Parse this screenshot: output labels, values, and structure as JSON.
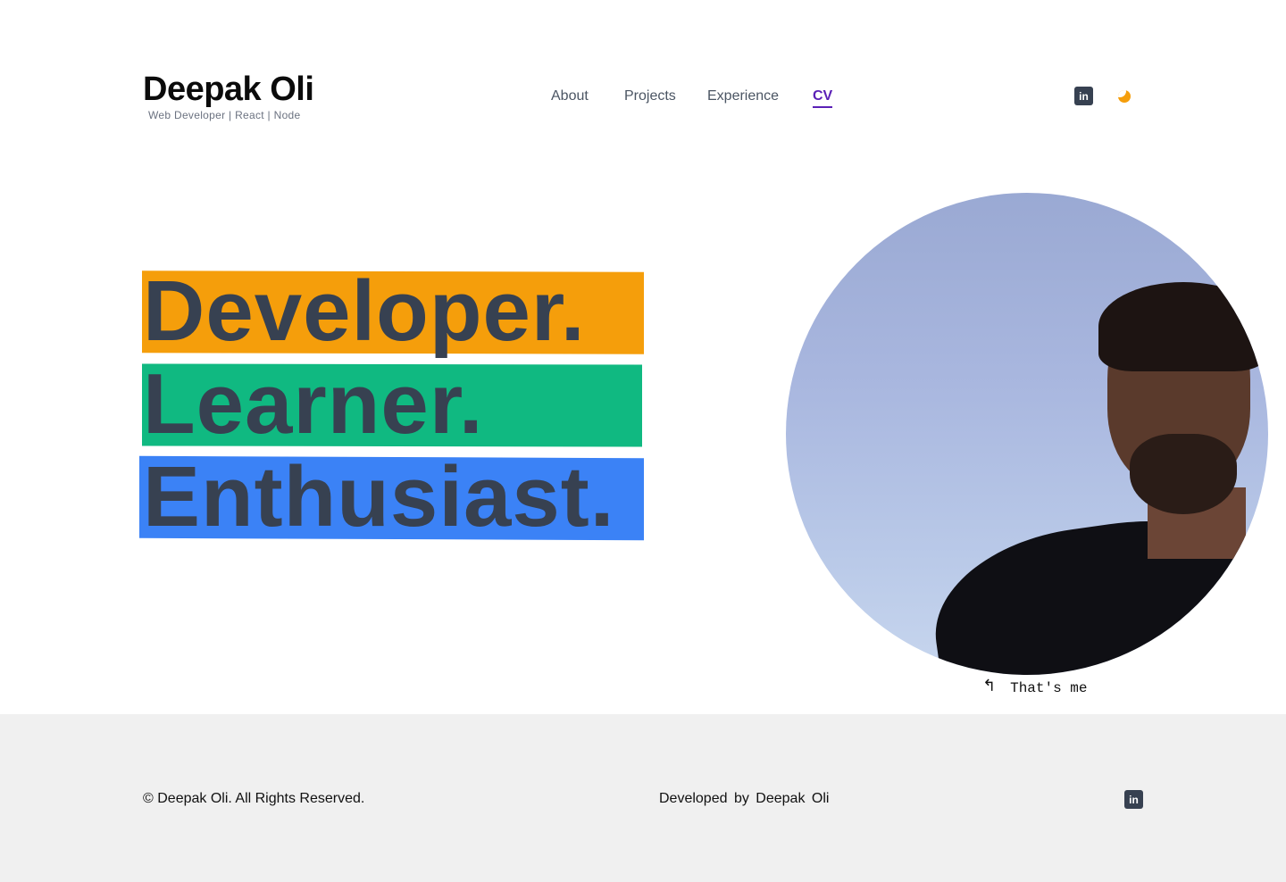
{
  "header": {
    "brand_name": "Deepak Oli",
    "brand_tagline": "Web Developer | React | Node",
    "nav": [
      "About",
      "Projects",
      "Experience",
      "CV"
    ],
    "active_nav": "CV",
    "icons": [
      "linkedin-icon",
      "moon-icon"
    ]
  },
  "hero": {
    "words": [
      "Developer.",
      "Learner.",
      "Enthusiast."
    ],
    "colors": [
      "#f59e0b",
      "#10b981",
      "#3b82f6"
    ],
    "caption": "That's me",
    "caption_arrow": "↰"
  },
  "footer": {
    "copyright": "© Deepak Oli. All Rights Reserved.",
    "developed_by": "Developed by  Deepak Oli",
    "icons": [
      "linkedin-icon"
    ]
  }
}
